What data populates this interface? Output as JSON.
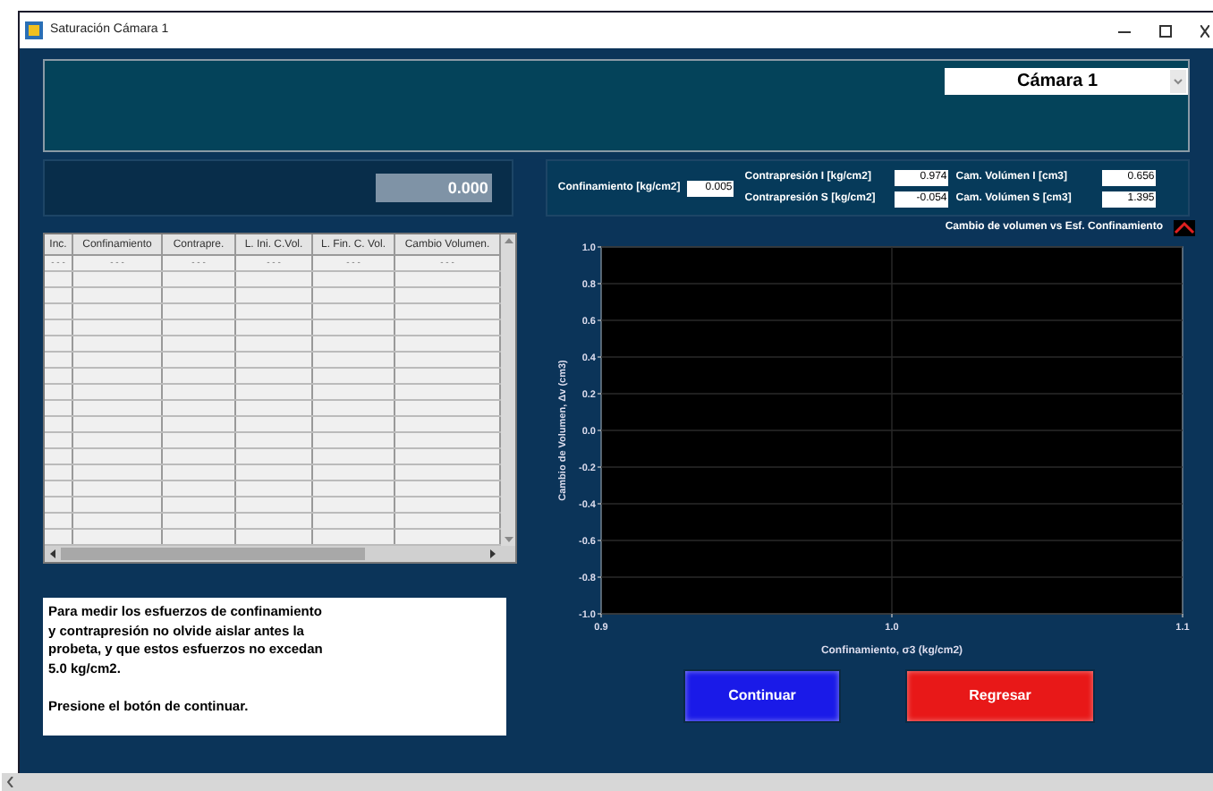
{
  "window": {
    "title": "Saturación Cámara 1"
  },
  "camera_select": {
    "value": "Cámara 1"
  },
  "readout": "0.000",
  "confinement": {
    "label": "Confinamiento  [kg/cm2]",
    "value": "0.005"
  },
  "fields": [
    {
      "label": "Contrapresión I  [kg/cm2]",
      "value": "0.974"
    },
    {
      "label": "Cam. Volúmen I [cm3]",
      "value": "0.656"
    },
    {
      "label": "Contrapresión S  [kg/cm2]",
      "value": "-0.054"
    },
    {
      "label": "Cam. Volúmen S [cm3]",
      "value": "1.395"
    }
  ],
  "table": {
    "columns": [
      "Inc.",
      "Confinamiento",
      "Contrapre.",
      "L. Ini. C.Vol.",
      "L. Fin. C. Vol.",
      "Cambio Volumen."
    ],
    "rows": [
      [
        "- - -",
        "- - -",
        "- - -",
        "- - -",
        "- - -",
        "- - -"
      ]
    ]
  },
  "message": [
    "Para medir los esfuerzos de confinamiento\ny contrapresión no olvide aislar antes la\nprobeta, y que estos esfuerzos no excedan\n5.0 kg/cm2.",
    "Presione el botón de continuar."
  ],
  "chart": {
    "chart_data": {
      "type": "line",
      "grid": true,
      "title": "Cambio de volumen vs Esf. Confinamiento",
      "xlabel": "Confinamiento, σ3 (kg/cm2)",
      "ylabel": "Cambio de Volumen, Δv (cm3)",
      "xlim": [
        0.9,
        1.1
      ],
      "ylim": [
        -1,
        1
      ],
      "xticks": [
        {
          "value": 0.9,
          "label": "0.9"
        },
        {
          "value": 1.0,
          "label": "1.0"
        },
        {
          "value": 1.1,
          "label": "1.1"
        }
      ],
      "yticks": [
        {
          "value": 1,
          "label": "1.0"
        },
        {
          "value": 0.8,
          "label": "0.8"
        },
        {
          "value": 0.6,
          "label": "0.6"
        },
        {
          "value": 0.4,
          "label": "0.4"
        },
        {
          "value": 0.2,
          "label": "0.2"
        },
        {
          "value": 0,
          "label": "0.0"
        },
        {
          "value": -0.2,
          "label": "-0.2"
        },
        {
          "value": -0.4,
          "label": "-0.4"
        },
        {
          "value": -0.6,
          "label": "-0.6"
        },
        {
          "value": -0.8,
          "label": "-0.8"
        },
        {
          "value": -1,
          "label": "-1.0"
        }
      ]
    }
  },
  "buttons": [
    {
      "label": "Continuar",
      "color": "#1a1ae8"
    },
    {
      "label": "Regresar",
      "color": "#e81818"
    }
  ]
}
